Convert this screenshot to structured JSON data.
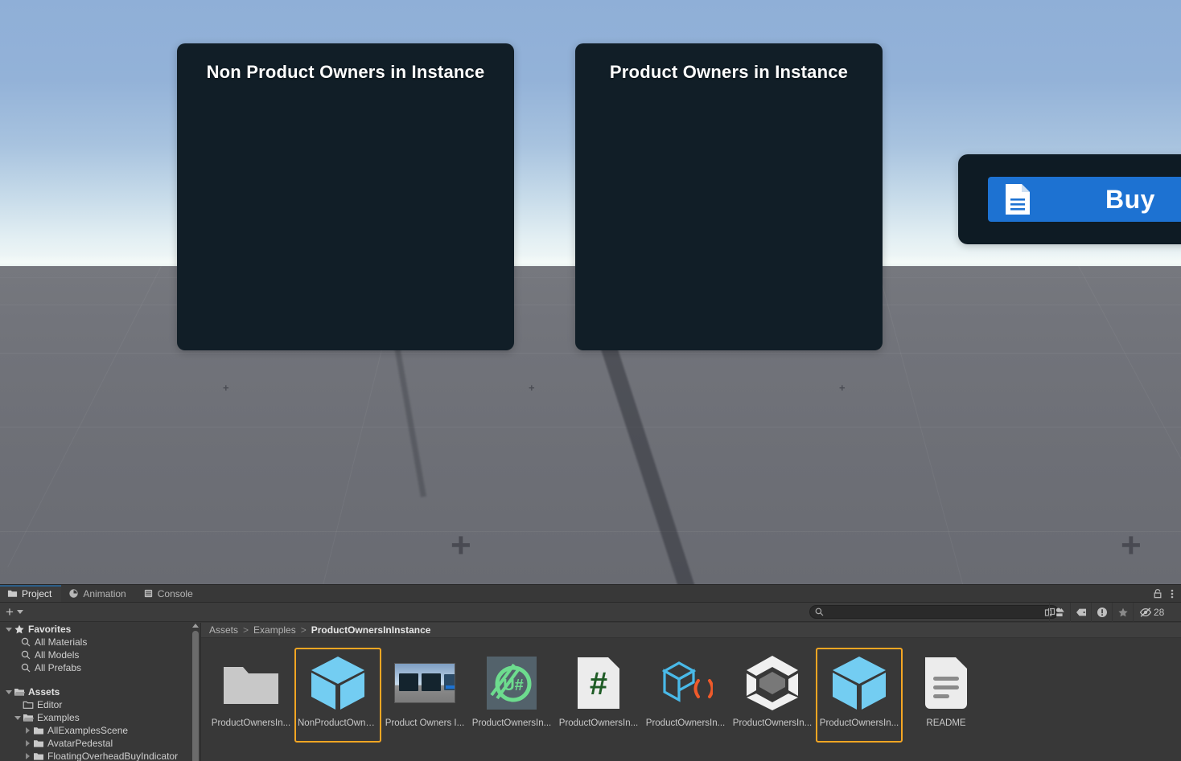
{
  "scene": {
    "boards": [
      {
        "id": "non-product-owners",
        "title": "Non Product Owners in Instance"
      },
      {
        "id": "product-owners",
        "title": "Product Owners in Instance"
      }
    ],
    "buy_board": {
      "button_label": "Buy",
      "button_icon": "document-icon",
      "button_color": "#1d72d2",
      "panel_color": "#0e1b24"
    },
    "sky_color_top": "#8fafd7",
    "sky_color_horizon": "#f2f8f7",
    "ground_color": "#6e7077"
  },
  "panel": {
    "tabs": [
      {
        "label": "Project",
        "icon": "folder-icon",
        "active": true
      },
      {
        "label": "Animation",
        "icon": "clock-icon",
        "active": false
      },
      {
        "label": "Console",
        "icon": "console-icon",
        "active": false
      }
    ],
    "lock_icon": "lock-icon",
    "menu_icon": "kebab-menu-icon",
    "toolbar": {
      "create_label": "+",
      "create_dropdown_icon": "chevron-down-icon",
      "search_value": "",
      "search_placeholder": "",
      "search_icon": "search-icon",
      "search_expand_icon": "expand-search-icon",
      "filter_icons": [
        {
          "name": "filter-by-type-icon"
        },
        {
          "name": "filter-by-label-icon"
        },
        {
          "name": "filter-warning-icon"
        },
        {
          "name": "filter-favorites-icon"
        }
      ],
      "hidden_icon": "eye-off-icon",
      "hidden_count": "28"
    },
    "tree": {
      "rows": [
        {
          "label": "Favorites",
          "depth": 0,
          "icon": "star-icon",
          "twisty": "down",
          "bold": true
        },
        {
          "label": "All Materials",
          "depth": 1,
          "icon": "search-icon",
          "twisty": "none",
          "bold": false
        },
        {
          "label": "All Models",
          "depth": 1,
          "icon": "search-icon",
          "twisty": "none",
          "bold": false
        },
        {
          "label": "All Prefabs",
          "depth": 1,
          "icon": "search-icon",
          "twisty": "none",
          "bold": false
        },
        {
          "label": "Assets",
          "depth": 0,
          "icon": "folder-open-icon",
          "twisty": "down",
          "bold": true
        },
        {
          "label": "Editor",
          "depth": 1,
          "icon": "folder-icon",
          "twisty": "none",
          "bold": false
        },
        {
          "label": "Examples",
          "depth": 1,
          "icon": "folder-open-icon",
          "twisty": "down",
          "bold": false
        },
        {
          "label": "AllExamplesScene",
          "depth": 2,
          "icon": "folder-icon",
          "twisty": "right",
          "bold": false
        },
        {
          "label": "AvatarPedestal",
          "depth": 2,
          "icon": "folder-icon",
          "twisty": "right",
          "bold": false
        },
        {
          "label": "FloatingOverheadBuyIndicator",
          "depth": 2,
          "icon": "folder-icon",
          "twisty": "right",
          "bold": false
        }
      ]
    },
    "breadcrumb": {
      "parts": [
        "Assets",
        "Examples"
      ],
      "current": "ProductOwnersInInstance",
      "separator": ">"
    },
    "grid": {
      "items": [
        {
          "label": "ProductOwnersIn...",
          "icon": "folder-asset-icon",
          "selected": false
        },
        {
          "label": "NonProductOwne...",
          "icon": "prefab-cube-icon",
          "selected": true
        },
        {
          "label": "Product Owners I...",
          "icon": "scene-thumbnail-icon",
          "selected": false
        },
        {
          "label": "ProductOwnersIn...",
          "icon": "udon-sharp-icon",
          "selected": false
        },
        {
          "label": "ProductOwnersIn...",
          "icon": "csharp-script-icon",
          "selected": false
        },
        {
          "label": "ProductOwnersIn...",
          "icon": "prefab-variant-icon",
          "selected": false
        },
        {
          "label": "ProductOwnersIn...",
          "icon": "unity-asset-icon",
          "selected": false
        },
        {
          "label": "ProductOwnersIn...",
          "icon": "prefab-cube-icon",
          "selected": true
        },
        {
          "label": "README",
          "icon": "text-document-icon",
          "selected": false
        }
      ],
      "selection_color": "#f5a623"
    }
  }
}
